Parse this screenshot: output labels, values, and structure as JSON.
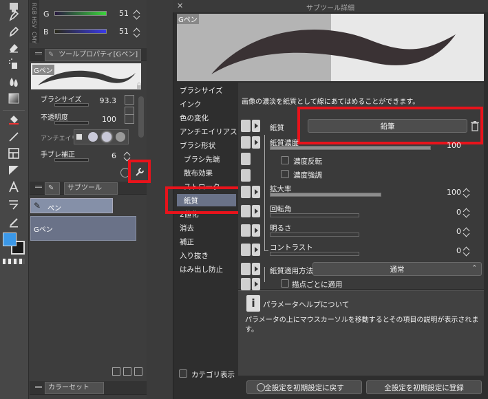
{
  "colors": {
    "accent_blue": "#3b98e8",
    "highlight_red": "#e8131b",
    "selection_bg": "#6a7288",
    "subtool_active": "#8590a8"
  },
  "color_slider": {
    "channel_g": "G",
    "value_g": "51",
    "channel_b": "B",
    "value_b": "51",
    "side_tab_1": "HSV",
    "side_tab_2": "CMY",
    "side_tab_3": "RGB"
  },
  "tool_property": {
    "tab_title": "ツールプロパティ[Gペン]",
    "preview_label": "Gペン",
    "brush_size_label": "ブラシサイズ",
    "brush_size_value": "93.3",
    "opacity_label": "不透明度",
    "opacity_value": "100",
    "antialias_label": "アンチエイリ",
    "stabilization_label": "手ブレ補正",
    "stabilization_value": "6"
  },
  "subtool": {
    "tab_title": "サブツール",
    "group_label": "ペン",
    "item_label": "Gペン"
  },
  "color_set": {
    "tab_title": "カラーセット"
  },
  "dialog": {
    "title": "サブツール詳細",
    "preview_label": "Gペン",
    "categories": [
      "ブラシサイズ",
      "インク",
      "色の変化",
      "アンチエイリアス",
      "ブラシ形状",
      "ブラシ先端",
      "散布効果",
      "ストローク",
      "紙質",
      "2値化",
      "消去",
      "補正",
      "入り抜き",
      "はみ出し防止"
    ],
    "selected_category": "紙質",
    "description": "画像の濃淡を紙質として線にあてはめることができます。",
    "paper_label": "紙質",
    "paper_value": "鉛筆",
    "paper_density_label": "紙質濃度",
    "paper_density_value": "100",
    "reverse_density_label": "濃度反転",
    "emphasize_density_label": "濃度強調",
    "scale_label": "拡大率",
    "scale_value": "100",
    "rotation_label": "回転角",
    "rotation_value": "0",
    "brightness_label": "明るさ",
    "brightness_value": "0",
    "contrast_label": "コントラスト",
    "contrast_value": "0",
    "apply_method_label": "紙質適用方法",
    "apply_method_value": "通常",
    "apply_each_tip_label": "描点ごとに適用",
    "help_title": "パラメータヘルプについて",
    "help_text": "パラメータの上にマウスカーソルを移動するとその項目の説明が表示されます。",
    "show_category_label": "カテゴリ表示",
    "reset_all_label": "全設定を初期設定に戻す",
    "register_all_label": "全設定を初期設定に登録"
  }
}
